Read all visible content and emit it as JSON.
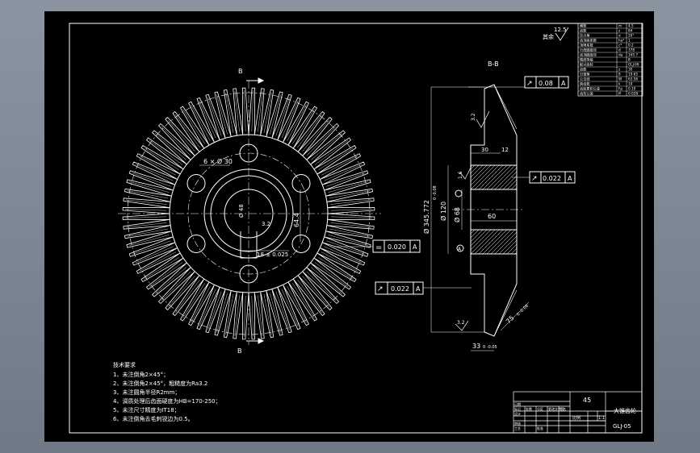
{
  "drawing": {
    "section_mark": "B",
    "section_title": "B-B",
    "surface_finish": {
      "value": "12.5",
      "prefix": "其余"
    },
    "roughness_symbols": [
      "3.2",
      "1.6",
      "3.2",
      "3.2"
    ],
    "material": "45",
    "part_name": "大锥齿轮",
    "drawing_number": "GLJ-05",
    "gear_teeth_count": 84
  },
  "front_view": {
    "hole_dim": "6 × Ø 30",
    "keyway_dim": "64.4",
    "bore_dim": "Ø 48",
    "angle_dim": "3.2",
    "key_width": "18 ± 0.025",
    "fcf_parallel": {
      "symbol": "=",
      "tol": "0.020",
      "datum": "A"
    }
  },
  "section_view": {
    "fcf_top": {
      "symbol": "↗",
      "tol": "0.08",
      "datum": "A"
    },
    "fcf_mid": {
      "symbol": "↗",
      "tol": "0.022",
      "datum": "A"
    },
    "fcf_left": {
      "symbol": "↗",
      "tol": "0.022",
      "datum": "A"
    },
    "dia_tip": "Ø 345.772",
    "dia_tip_tol": "0\n-0.08",
    "dia_hub": "Ø 120",
    "dia_bore": "Ø 68",
    "width_60": "60",
    "dim_30": "30",
    "dim_12": "12",
    "dim_33": "33",
    "dim_33_tol": "0\n-0.05",
    "dim_75": "75",
    "dim_75_tol": "0\n-0.08",
    "datum": "A"
  },
  "tech_notes": {
    "title": "技术要求",
    "items": [
      "1、未注倒角2×45°；",
      "2、未注倒角2×45°，粗糙度为Ra3.2",
      "3、未注圆角半径R2mm；",
      "4、调质处理后齿面硬度为HB=170-250；",
      "5、未注尺寸精度为IT18；",
      "6、未注倒角去毛刺锐边为0.5。"
    ]
  },
  "param_table": {
    "rows": [
      [
        "模数",
        "m",
        "4.5"
      ],
      [
        "齿数",
        "z",
        "84"
      ],
      [
        "压力角",
        "α",
        "20°"
      ],
      [
        "齿顶高系数",
        "ha*",
        "1"
      ],
      [
        "顶隙系数",
        "c*",
        "0.2"
      ],
      [
        "分度圆直径",
        "d",
        "378"
      ],
      [
        "齿顶圆直径",
        "da",
        "345.7"
      ],
      [
        "精度等级",
        "",
        "8"
      ],
      [
        "配对齿轮",
        "",
        "GLJ-06"
      ],
      [
        "齿数",
        "z",
        "30"
      ],
      [
        "分锥角",
        "δ",
        "19.65"
      ],
      [
        "公法线",
        "W",
        "63.56"
      ],
      [
        "跨齿数",
        "k",
        "10"
      ],
      [
        "齿距累积公差",
        "Fp",
        "0.10"
      ],
      [
        "齿形公差",
        "ff",
        "0.028"
      ]
    ]
  },
  "title_block": {
    "material": "45",
    "name": "大锥齿轮",
    "number": "GLJ-05",
    "scale_label": "比例",
    "scale": "1:1",
    "designer_label": "设计",
    "checker_label": "审核",
    "process_label": "工艺",
    "approve_label": "批准",
    "stage_labels": [
      "标记",
      "处数",
      "分区",
      "更改文件号",
      "签名",
      "日期"
    ]
  }
}
